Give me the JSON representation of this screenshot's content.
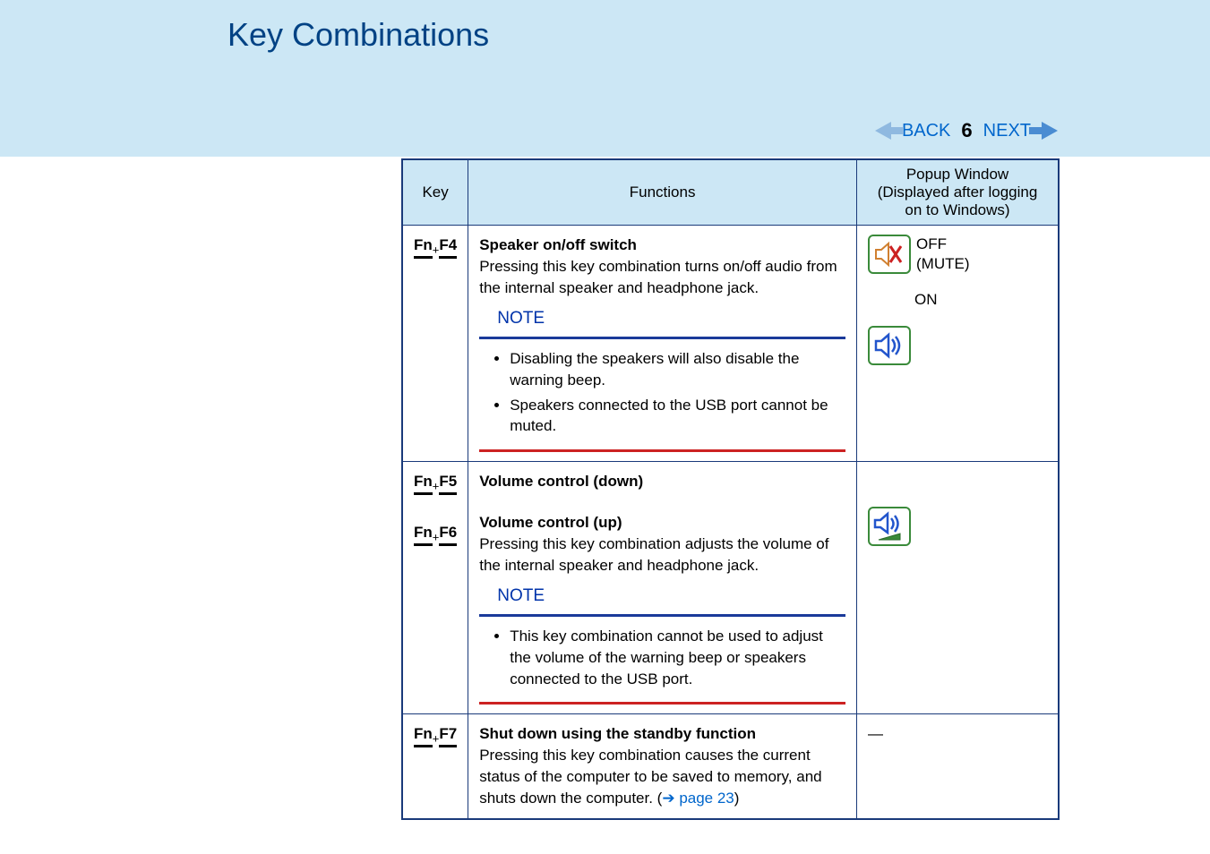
{
  "page_title": "Key Combinations",
  "nav": {
    "back_label": "BACK",
    "next_label": "NEXT",
    "page_number": "6"
  },
  "table": {
    "headers": {
      "key": "Key",
      "functions": "Functions",
      "popup": "Popup Window\n(Displayed after logging\non to Windows)"
    },
    "rows": {
      "f4": {
        "key_fn": "Fn",
        "key_fx": "F4",
        "title": "Speaker on/off switch",
        "desc": "Pressing this key combination turns on/off audio from the internal speaker and headphone jack.",
        "note_label": "NOTE",
        "note_items": [
          "Disabling the speakers will also disable the warning beep.",
          "Speakers connected to the USB port cannot be muted."
        ],
        "popup_off": "OFF\n(MUTE)",
        "popup_on": "ON"
      },
      "f5": {
        "key_fn": "Fn",
        "key_fx": "F5",
        "title": "Volume control (down)"
      },
      "f6": {
        "key_fn": "Fn",
        "key_fx": "F6",
        "title": "Volume control (up)",
        "desc": "Pressing this key combination adjusts the volume of the internal speaker and headphone jack.",
        "note_label": "NOTE",
        "note_items": [
          "This key combination cannot be used to adjust the volume of the warning beep or speakers connected to the USB port."
        ]
      },
      "f7": {
        "key_fn": "Fn",
        "key_fx": "F7",
        "title": "Shut down using the standby function",
        "desc_pre": "Pressing this key combination causes the current status of the computer to be saved to memory, and shuts down the computer. (",
        "link_arrow": "➔",
        "link_text": "page 23",
        "desc_post": ")",
        "popup_dash": "—"
      }
    }
  }
}
